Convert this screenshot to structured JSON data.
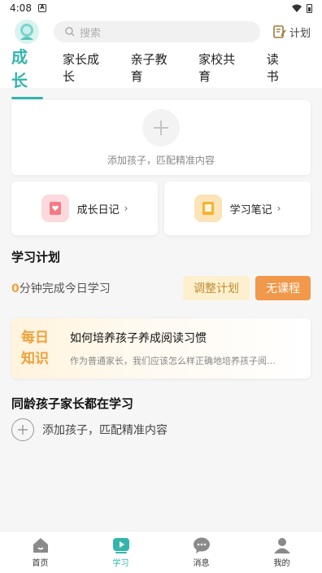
{
  "status_bar": {
    "time": "4:08",
    "notif_glyph": "A"
  },
  "header": {
    "search_placeholder": "搜索",
    "plan_label": "计划"
  },
  "tabs": [
    {
      "label": "成长",
      "active": true
    },
    {
      "label": "家长成长",
      "active": false
    },
    {
      "label": "亲子教育",
      "active": false
    },
    {
      "label": "家校共育",
      "active": false
    },
    {
      "label": "读书",
      "active": false
    }
  ],
  "add_child_card": {
    "label": "添加孩子，匹配精准内容"
  },
  "shortcuts": {
    "diary_label": "成长日记",
    "notes_label": "学习笔记",
    "chevron": "›"
  },
  "study_plan": {
    "title": "学习计划",
    "minutes": "0",
    "suffix": "分钟完成今日学习",
    "adjust_label": "调整计划",
    "course_label": "无课程"
  },
  "daily": {
    "badge_line1": "每日",
    "badge_line2": "知识",
    "title": "如何培养孩子养成阅读习惯",
    "desc": "作为普通家长，我们应该怎么样正确地培养孩子阅…"
  },
  "peers": {
    "title": "同龄孩子家长都在学习",
    "add_label": "添加孩子，匹配精准内容"
  },
  "bottom_nav": [
    {
      "label": "首页",
      "icon": "home-icon",
      "active": false
    },
    {
      "label": "学习",
      "icon": "play-icon",
      "active": true
    },
    {
      "label": "消息",
      "icon": "chat-icon",
      "active": false
    },
    {
      "label": "我的",
      "icon": "person-icon",
      "active": false
    }
  ],
  "colors": {
    "accent": "#33b5ac",
    "orange": "#f2984a",
    "adjust_bg": "#fdf0cf"
  }
}
